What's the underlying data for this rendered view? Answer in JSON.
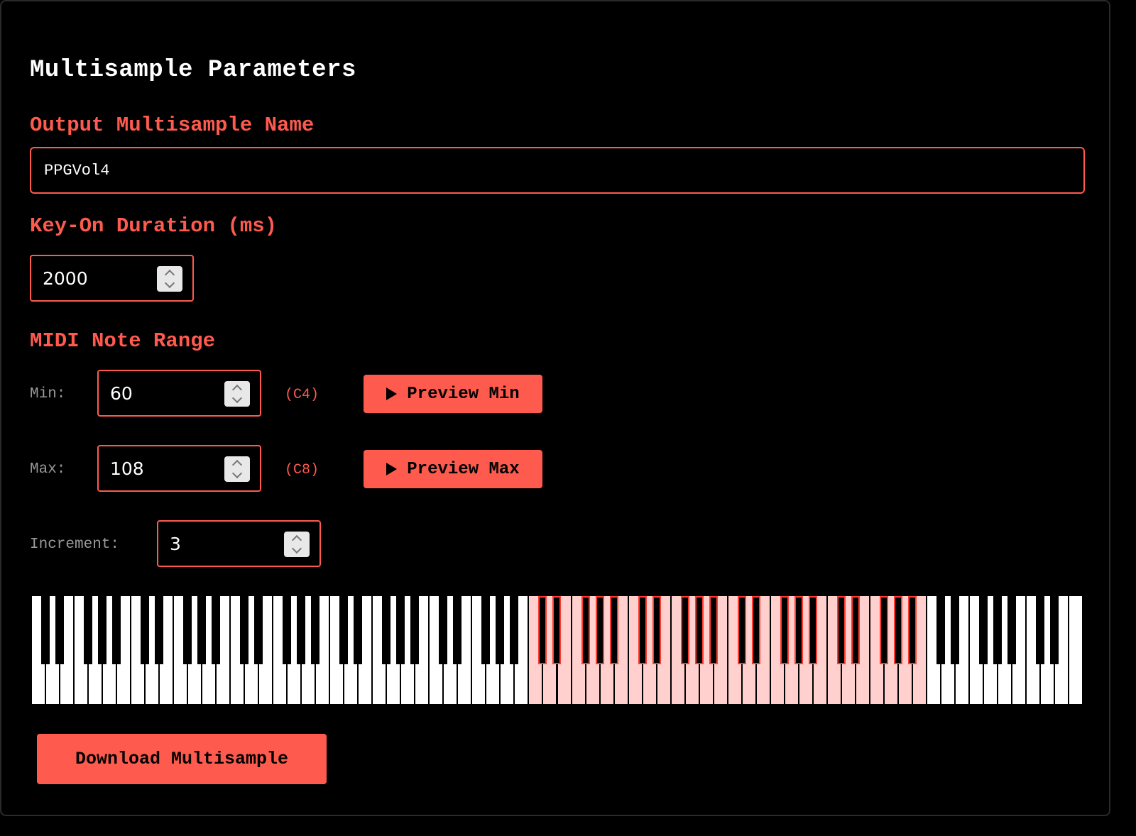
{
  "title": "Multisample Parameters",
  "output_name": {
    "label": "Output Multisample Name",
    "value": "PPGVol4"
  },
  "key_on": {
    "label": "Key-On Duration (ms)",
    "value": "2000"
  },
  "midi_range": {
    "label": "MIDI Note Range",
    "min": {
      "label": "Min:",
      "value": "60",
      "note": "(C4)",
      "preview_label": "Preview Min"
    },
    "max": {
      "label": "Max:",
      "value": "108",
      "note": "(C8)",
      "preview_label": "Preview Max"
    },
    "increment": {
      "label": "Increment:",
      "value": "3"
    }
  },
  "keyboard": {
    "selected_fraction_start": 0.467,
    "selected_fraction_end": 0.848
  },
  "download_label": "Download Multisample",
  "colors": {
    "accent": "#ff5a4e",
    "selected_key": "#ffd0cd",
    "background": "#000000"
  }
}
